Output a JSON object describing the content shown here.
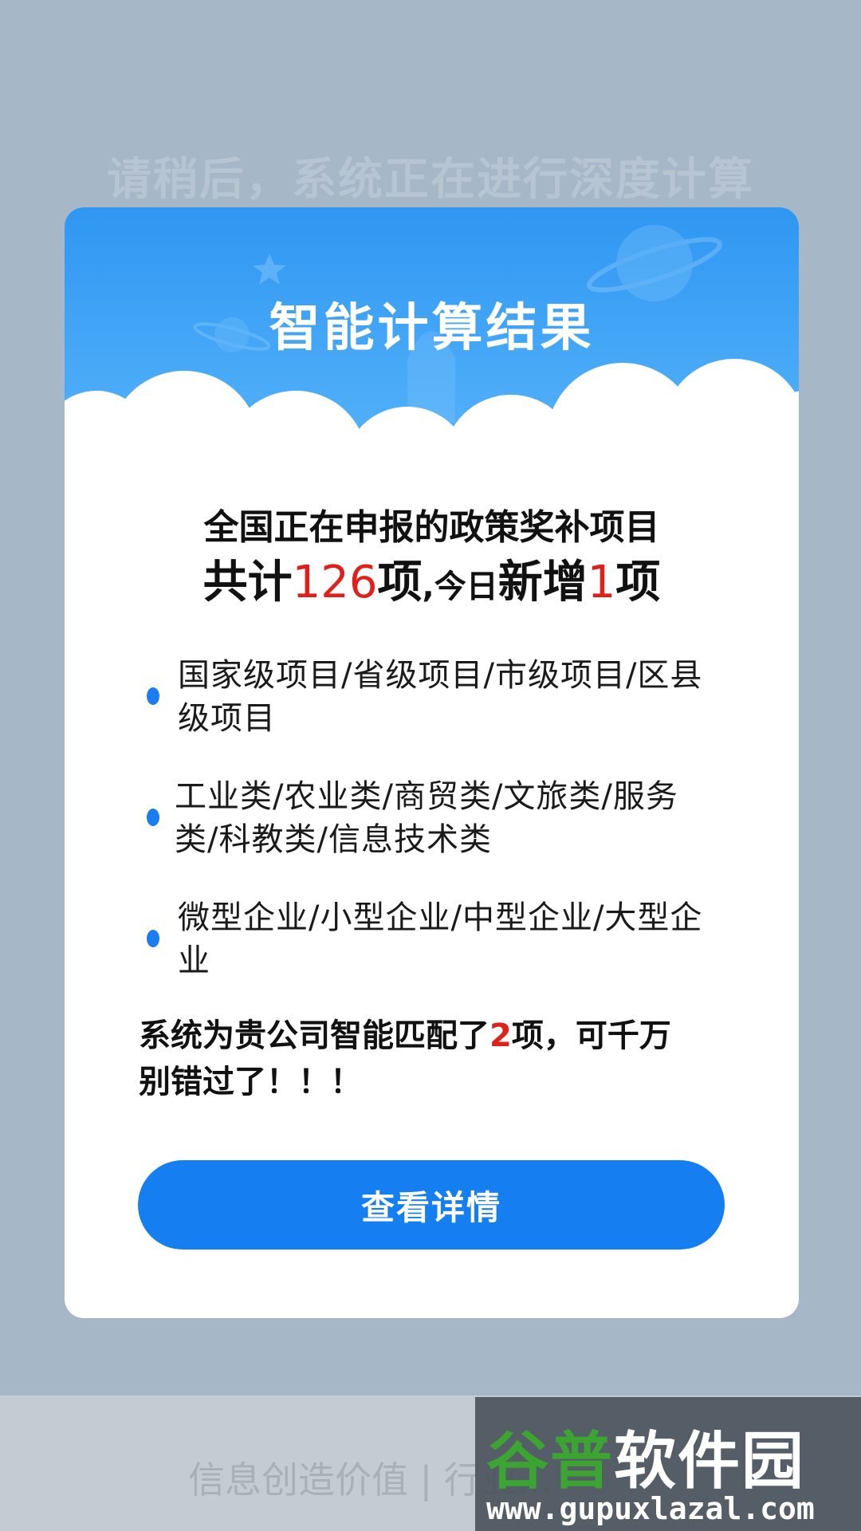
{
  "background": {
    "loading_text": "请稍后，系统正在进行深度计算",
    "footer_text": "信息创造价值 | 行业..."
  },
  "watermark": {
    "logo_part1": "谷普",
    "logo_part2": "软件园",
    "url": "www.gupuxlazal.com"
  },
  "card": {
    "title": "智能计算结果",
    "headline_line1": "全国正在申报的政策奖补项目",
    "headline_line2": {
      "prefix": "共计",
      "total_count": "126",
      "middle_big": "项",
      "middle_small": ",今日",
      "suffix_text": "新增",
      "new_count": "1",
      "end": "项"
    },
    "categories": [
      {
        "text": "国家级项目/省级项目/市级项目/区县级项目"
      },
      {
        "text": "工业类/农业类/商贸类/文旅类/服务类/科教类/信息技术类"
      },
      {
        "text": "微型企业/小型企业/中型企业/大型企业"
      }
    ],
    "conclusion": {
      "before": "系统为贵公司智能匹配了",
      "count": "2",
      "after": "项，可千万别错过了！！！"
    },
    "button_label": "查看详情"
  },
  "colors": {
    "page_bg": "#a6b7c8",
    "header_blue": "#2f97f2",
    "button_blue": "#157ef0",
    "highlight_red": "#e0201b"
  }
}
